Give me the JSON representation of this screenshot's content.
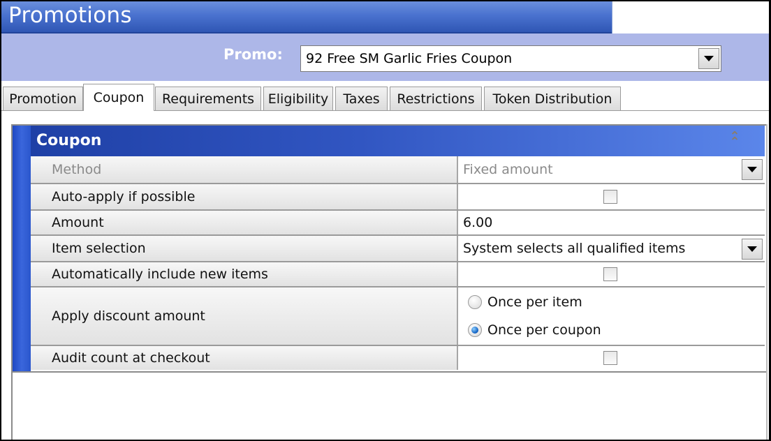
{
  "window": {
    "title": "Promotions"
  },
  "promo": {
    "label": "Promo:",
    "selected": "92 Free SM Garlic Fries Coupon"
  },
  "tabs": [
    {
      "label": "Promotion",
      "active": false
    },
    {
      "label": "Coupon",
      "active": true
    },
    {
      "label": "Requirements",
      "active": false
    },
    {
      "label": "Eligibility",
      "active": false
    },
    {
      "label": "Taxes",
      "active": false
    },
    {
      "label": "Restrictions",
      "active": false
    },
    {
      "label": "Token Distribution",
      "active": false
    }
  ],
  "section": {
    "title": "Coupon",
    "collapse_icon": "double-chevron-up-icon",
    "fields": {
      "method": {
        "label": "Method",
        "value": "Fixed amount",
        "disabled": true
      },
      "auto_apply": {
        "label": "Auto-apply if possible",
        "checked": false
      },
      "amount": {
        "label": "Amount",
        "value": "6.00"
      },
      "item_selection": {
        "label": "Item selection",
        "value": "System selects all qualified items"
      },
      "auto_include": {
        "label": "Automatically include new items",
        "checked": false
      },
      "apply_discount": {
        "label": "Apply discount amount",
        "options": [
          "Once per item",
          "Once per coupon"
        ],
        "selected": "Once per coupon"
      },
      "audit_count": {
        "label": "Audit count at checkout",
        "checked": false
      }
    }
  },
  "colors": {
    "title_bar": "#3a62c6",
    "promo_bar": "#adb7e8",
    "section_header": "#3156c2",
    "accent": "#2a56cc"
  }
}
